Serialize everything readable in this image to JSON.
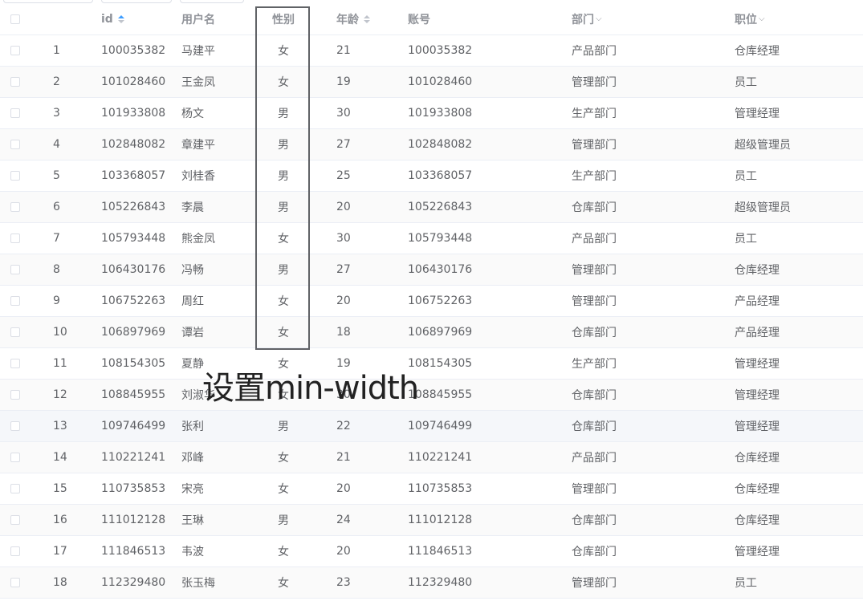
{
  "table": {
    "columns": {
      "id": "id",
      "username": "用户名",
      "gender": "性别",
      "age": "年龄",
      "account": "账号",
      "department": "部门",
      "position": "职位"
    },
    "rows": [
      {
        "index": "1",
        "id": "100035382",
        "username": "马建平",
        "gender": "女",
        "age": "21",
        "account": "100035382",
        "department": "产品部门",
        "position": "仓库经理"
      },
      {
        "index": "2",
        "id": "101028460",
        "username": "王金凤",
        "gender": "女",
        "age": "19",
        "account": "101028460",
        "department": "管理部门",
        "position": "员工"
      },
      {
        "index": "3",
        "id": "101933808",
        "username": "杨文",
        "gender": "男",
        "age": "30",
        "account": "101933808",
        "department": "生产部门",
        "position": "管理经理"
      },
      {
        "index": "4",
        "id": "102848082",
        "username": "章建平",
        "gender": "男",
        "age": "27",
        "account": "102848082",
        "department": "管理部门",
        "position": "超级管理员"
      },
      {
        "index": "5",
        "id": "103368057",
        "username": "刘桂香",
        "gender": "男",
        "age": "25",
        "account": "103368057",
        "department": "生产部门",
        "position": "员工"
      },
      {
        "index": "6",
        "id": "105226843",
        "username": "李晨",
        "gender": "男",
        "age": "20",
        "account": "105226843",
        "department": "仓库部门",
        "position": "超级管理员"
      },
      {
        "index": "7",
        "id": "105793448",
        "username": "熊金凤",
        "gender": "女",
        "age": "30",
        "account": "105793448",
        "department": "产品部门",
        "position": "员工"
      },
      {
        "index": "8",
        "id": "106430176",
        "username": "冯畅",
        "gender": "男",
        "age": "27",
        "account": "106430176",
        "department": "管理部门",
        "position": "仓库经理"
      },
      {
        "index": "9",
        "id": "106752263",
        "username": "周红",
        "gender": "女",
        "age": "20",
        "account": "106752263",
        "department": "管理部门",
        "position": "产品经理"
      },
      {
        "index": "10",
        "id": "106897969",
        "username": "谭岩",
        "gender": "女",
        "age": "18",
        "account": "106897969",
        "department": "仓库部门",
        "position": "产品经理"
      },
      {
        "index": "11",
        "id": "108154305",
        "username": "夏静",
        "gender": "女",
        "age": "19",
        "account": "108154305",
        "department": "生产部门",
        "position": "管理经理"
      },
      {
        "index": "12",
        "id": "108845955",
        "username": "刘淑华",
        "gender": "女",
        "age": "30",
        "account": "108845955",
        "department": "仓库部门",
        "position": "管理经理"
      },
      {
        "index": "13",
        "id": "109746499",
        "username": "张利",
        "gender": "男",
        "age": "22",
        "account": "109746499",
        "department": "仓库部门",
        "position": "管理经理"
      },
      {
        "index": "14",
        "id": "110221241",
        "username": "邓峰",
        "gender": "女",
        "age": "21",
        "account": "110221241",
        "department": "产品部门",
        "position": "仓库经理"
      },
      {
        "index": "15",
        "id": "110735853",
        "username": "宋亮",
        "gender": "女",
        "age": "20",
        "account": "110735853",
        "department": "管理部门",
        "position": "仓库经理"
      },
      {
        "index": "16",
        "id": "111012128",
        "username": "王琳",
        "gender": "男",
        "age": "24",
        "account": "111012128",
        "department": "仓库部门",
        "position": "仓库经理"
      },
      {
        "index": "17",
        "id": "111846513",
        "username": "韦波",
        "gender": "女",
        "age": "20",
        "account": "111846513",
        "department": "仓库部门",
        "position": "管理经理"
      },
      {
        "index": "18",
        "id": "112329480",
        "username": "张玉梅",
        "gender": "女",
        "age": "23",
        "account": "112329480",
        "department": "管理部门",
        "position": "员工"
      }
    ]
  },
  "annotation": {
    "text": "设置min-width"
  },
  "colors": {
    "header_text": "#909399",
    "body_text": "#606266",
    "border": "#ebeef5",
    "sort_active": "#409eff",
    "stripe": "#fafafa",
    "hover_row": "#f5f7fa"
  }
}
